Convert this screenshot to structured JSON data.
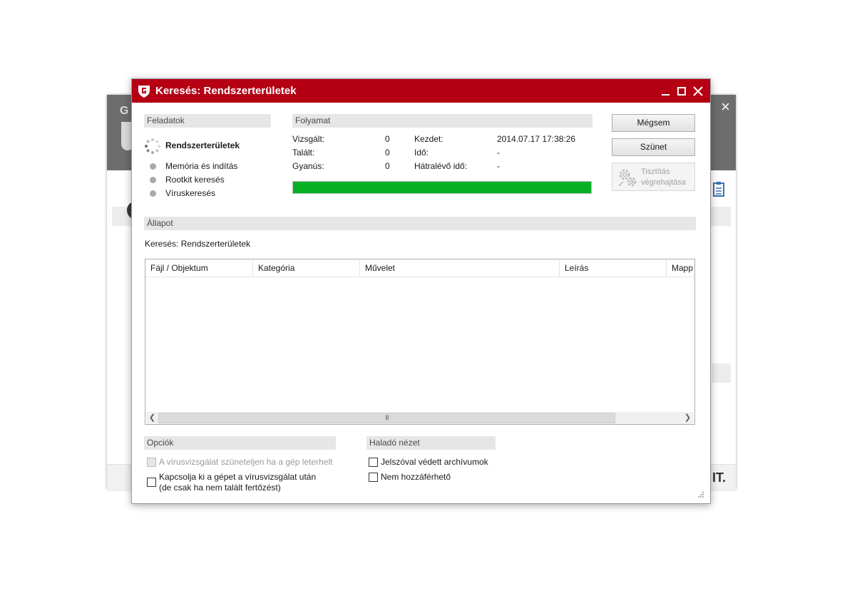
{
  "background_window": {
    "logo_text": "G",
    "close_glyph": "×",
    "footer_text": "IT."
  },
  "dialog": {
    "title": "Keresés: Rendszerterületek",
    "icon": "gdata-shield-icon",
    "controls": {
      "minimize": "minimize-icon",
      "maximize": "maximize-icon",
      "close": "close-icon"
    },
    "colors": {
      "titlebar": "#b50014",
      "progress": "#06b025"
    }
  },
  "tasks": {
    "header": "Feladatok",
    "active": "Rendszerterületek",
    "items": [
      "Memória és indítás",
      "Rootkit keresés",
      "Víruskeresés"
    ]
  },
  "progress": {
    "header": "Folyamat",
    "stats": [
      {
        "label": "Vizsgált:",
        "value": "0"
      },
      {
        "label": "Talált:",
        "value": "0"
      },
      {
        "label": "Gyanús:",
        "value": "0"
      }
    ],
    "times": [
      {
        "label": "Kezdet:",
        "value": "2014.07.17 17:38:26"
      },
      {
        "label": "Idő:",
        "value": "-"
      },
      {
        "label": "Hátralévő idő:",
        "value": "-"
      }
    ],
    "bar_fraction": 1.0
  },
  "buttons": {
    "cancel": "Mégsem",
    "pause": "Szünet",
    "clean_line1": "Tisztítás",
    "clean_line2": "végrehajtása"
  },
  "status": {
    "header": "Állapot",
    "text": "Keresés: Rendszerterületek"
  },
  "table": {
    "columns": [
      "Fájl / Objektum",
      "Kategória",
      "Művelet",
      "Leírás",
      "Mapp"
    ],
    "rows": [],
    "scroll_thumb": "III"
  },
  "options": {
    "header": "Opciók",
    "pause_when_busy": {
      "label": "A vírusvizsgálat szüneteljen ha a gép leterhelt",
      "checked": false,
      "enabled": false
    },
    "shutdown_line1": "Kapcsolja ki a gépet a vírusvizsgálat után",
    "shutdown_line2": "(de csak ha nem talált fertőzést)",
    "shutdown_checked": false
  },
  "advanced": {
    "header": "Haladó nézet",
    "password_archives": {
      "label": "Jelszóval védett archívumok",
      "checked": false
    },
    "inaccessible": {
      "label": "Nem hozzáférhető",
      "checked": false
    }
  }
}
